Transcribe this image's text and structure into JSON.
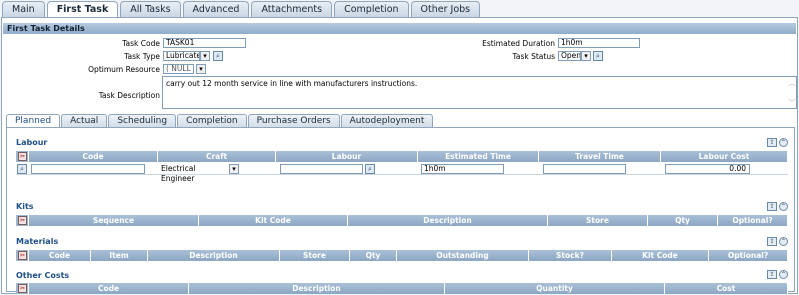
{
  "tabs": [
    "Main",
    "First Task",
    "All Tasks",
    "Advanced",
    "Attachments",
    "Completion",
    "Other Jobs"
  ],
  "active_tab": "First Task",
  "section_title": "First Task Details",
  "fields": {
    "task_code_label": "Task Code",
    "task_code": "TASK01",
    "task_type_label": "Task Type",
    "task_type": "Lubricate",
    "optimum_resource_label": "Optimum Resource",
    "optimum_resource": "( NULL )",
    "task_description_label": "Task Description",
    "task_description": "carry out 12 month service in line with manufacturers instructions.",
    "estimated_duration_label": "Estimated Duration",
    "estimated_duration": "1h0m",
    "task_status_label": "Task Status",
    "task_status": "Open"
  },
  "subtabs": [
    "Planned",
    "Actual",
    "Scheduling",
    "Completion",
    "Purchase Orders",
    "Autodeployment"
  ],
  "active_subtab": "Planned",
  "labour": {
    "title": "Labour",
    "columns": [
      "Code",
      "Craft",
      "Labour",
      "Estimated Time",
      "Travel Time",
      "Labour Cost"
    ],
    "row": {
      "code": "",
      "craft": "Electrical Engineer",
      "labour": "",
      "estimated_time": "1h0m",
      "travel_time": "",
      "labour_cost": "0.00"
    }
  },
  "kits": {
    "title": "Kits",
    "columns": [
      "Sequence",
      "Kit Code",
      "Description",
      "Store",
      "Qty",
      "Optional?"
    ]
  },
  "materials": {
    "title": "Materials",
    "columns": [
      "Code",
      "Item",
      "Description",
      "Store",
      "Qty",
      "Outstanding",
      "Stock?",
      "Kit Code",
      "Optional?"
    ]
  },
  "other_costs": {
    "title": "Other Costs",
    "columns": [
      "Code",
      "Description",
      "Quantity",
      "Cost"
    ]
  },
  "icons": {
    "select_arrow": "chevron-down-icon",
    "lookup": "magnifier-icon",
    "remove_row": "remove-row-icon",
    "export": "export-icon",
    "collapse": "collapse-up-icon"
  }
}
